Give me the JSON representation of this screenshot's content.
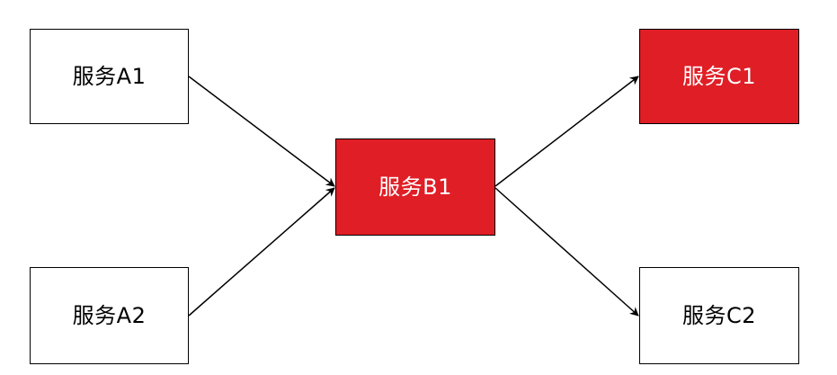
{
  "nodes": {
    "a1": {
      "label": "服务A1",
      "style": "normal"
    },
    "a2": {
      "label": "服务A2",
      "style": "normal"
    },
    "b1": {
      "label": "服务B1",
      "style": "highlight"
    },
    "c1": {
      "label": "服务C1",
      "style": "highlight"
    },
    "c2": {
      "label": "服务C2",
      "style": "normal"
    }
  },
  "edges": [
    {
      "from": "a1",
      "to": "b1"
    },
    {
      "from": "a2",
      "to": "b1"
    },
    {
      "from": "b1",
      "to": "c1"
    },
    {
      "from": "b1",
      "to": "c2"
    }
  ],
  "colors": {
    "highlight_fill": "#e01e26",
    "normal_fill": "#ffffff",
    "border": "#000000",
    "arrow": "#000000"
  }
}
